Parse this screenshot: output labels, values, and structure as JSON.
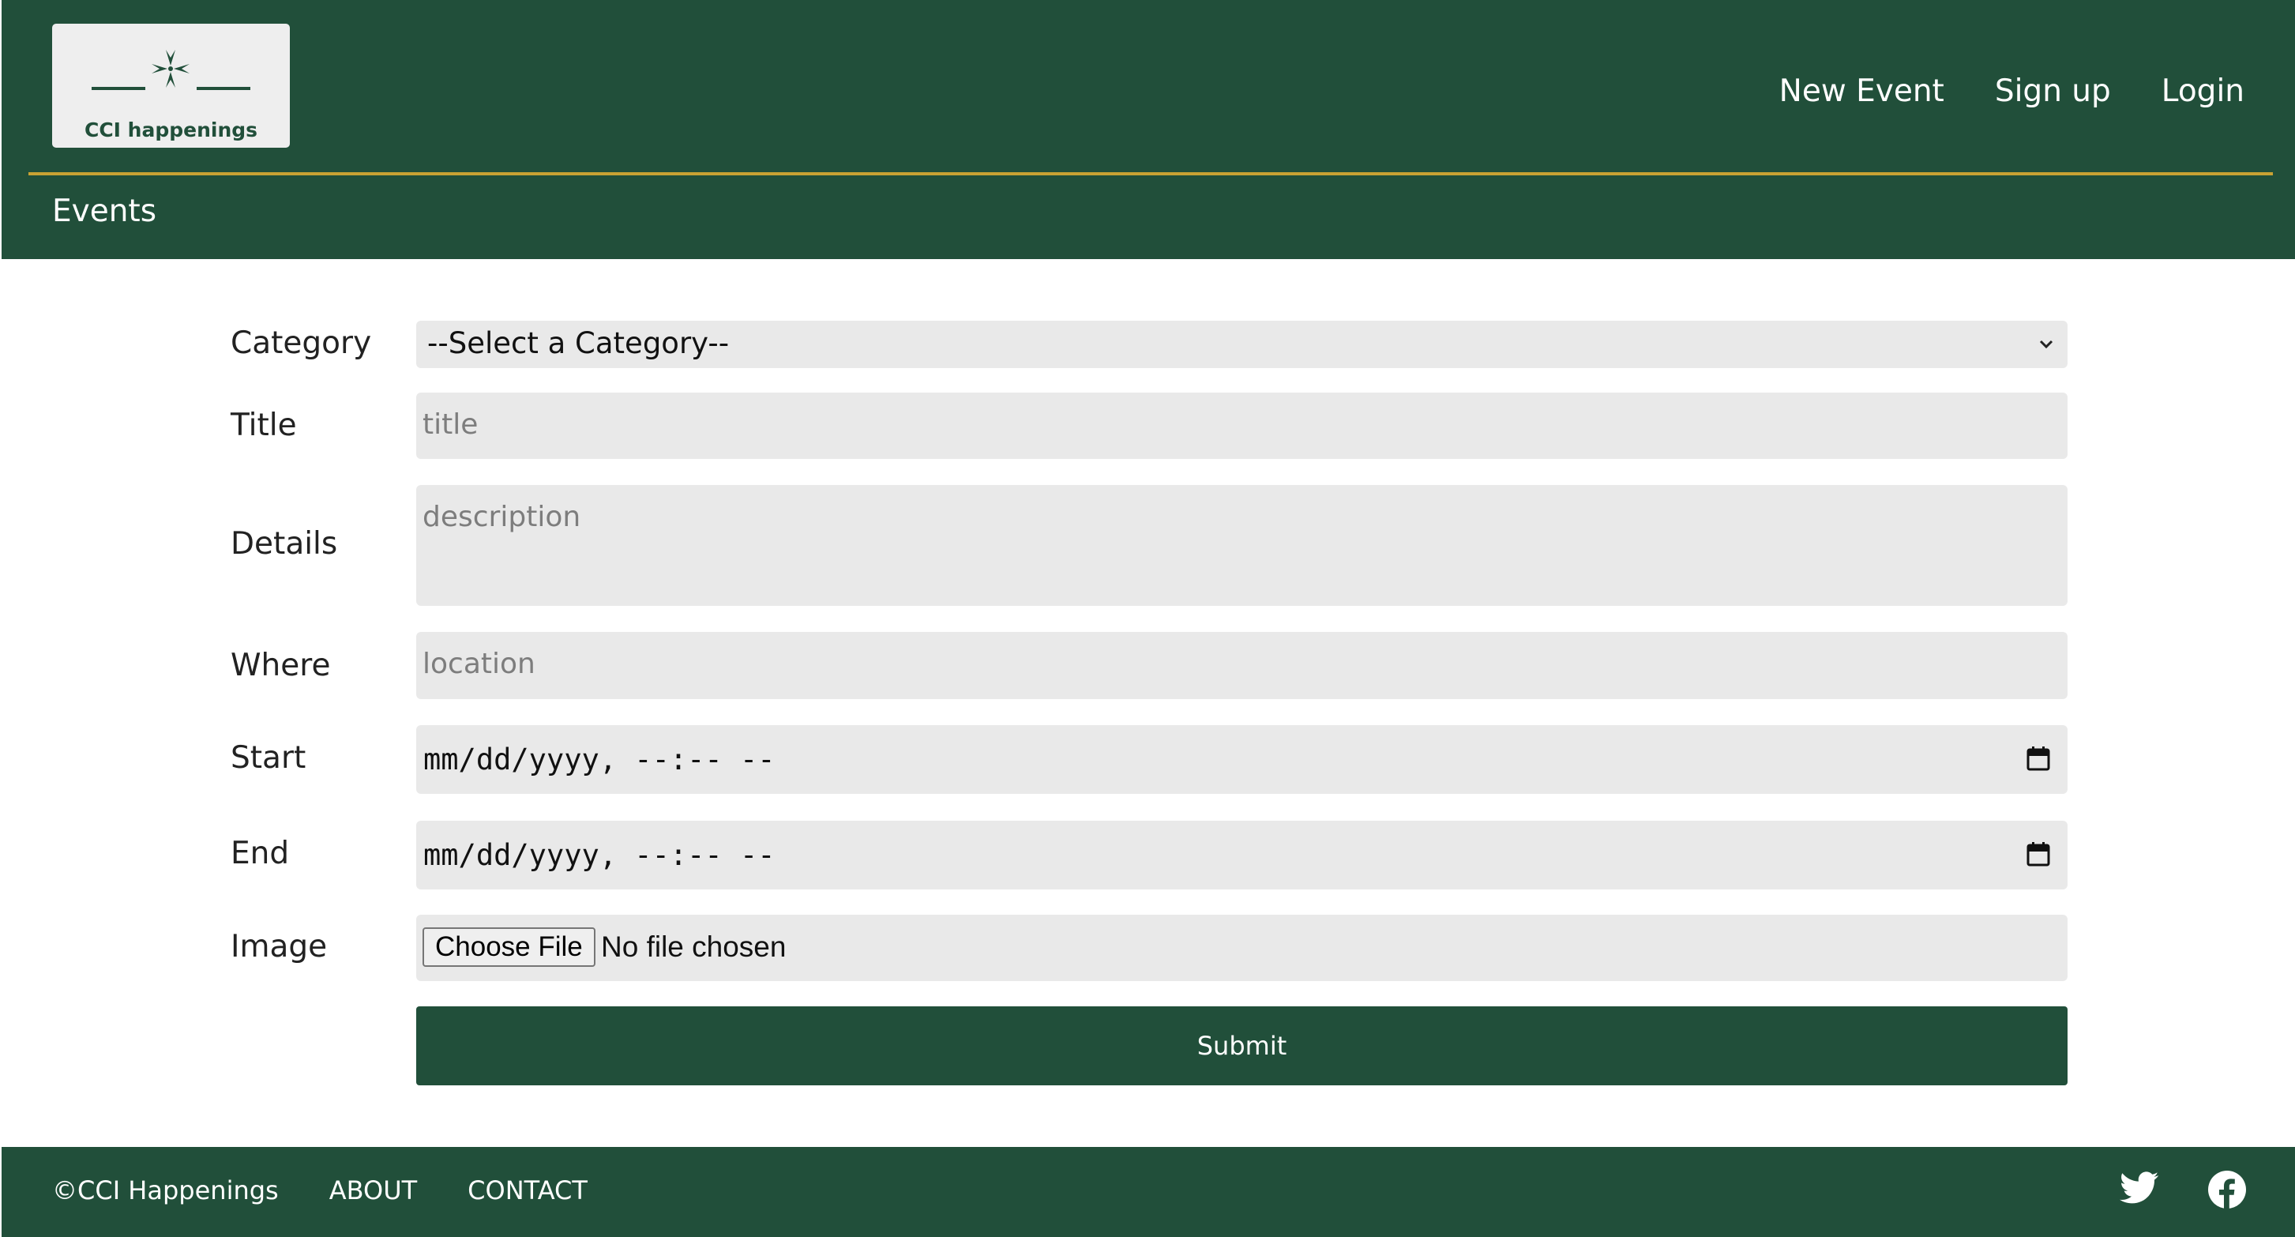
{
  "header": {
    "logo_text": "CCI happenings",
    "nav": [
      {
        "label": "New Event"
      },
      {
        "label": "Sign up"
      },
      {
        "label": "Login"
      }
    ],
    "section_title": "Events"
  },
  "form": {
    "category": {
      "label": "Category",
      "value": "--Select a Category--"
    },
    "title": {
      "label": "Title",
      "placeholder": "title"
    },
    "details": {
      "label": "Details",
      "placeholder": "description"
    },
    "where": {
      "label": "Where",
      "placeholder": "location"
    },
    "start": {
      "label": "Start",
      "value": "mm/dd/yyyy, --:-- --"
    },
    "end": {
      "label": "End",
      "value": "mm/dd/yyyy, --:-- --"
    },
    "image": {
      "label": "Image",
      "button_label": "Choose File",
      "status": "No file chosen"
    },
    "submit_label": "Submit"
  },
  "footer": {
    "copyright": "©CCI Happenings",
    "links": [
      {
        "label": "ABOUT"
      },
      {
        "label": "CONTACT"
      }
    ],
    "social_icons": [
      "twitter-icon",
      "facebook-icon"
    ]
  },
  "colors": {
    "brand_green": "#214f3a",
    "accent_gold": "#c9a233",
    "field_bg": "#e9e9e9"
  }
}
